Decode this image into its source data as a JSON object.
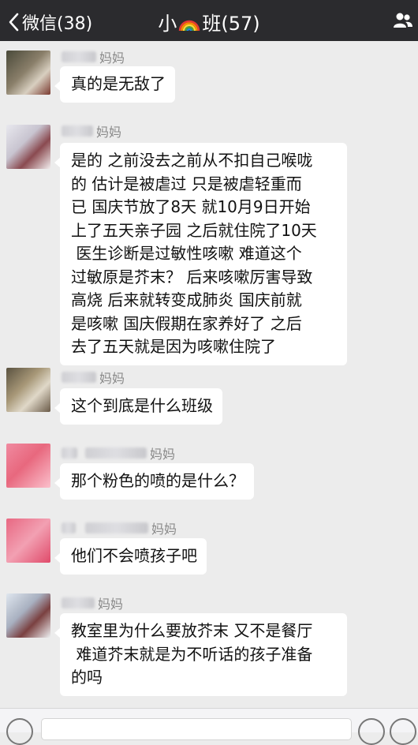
{
  "navbar": {
    "back_label": "微信(38)",
    "title_prefix": "小",
    "title_suffix": "班(57)"
  },
  "messages": [
    {
      "nick": "妈妈",
      "text": "真的是无敌了"
    },
    {
      "nick": "妈妈",
      "text": "是的 之前没去之前从不扣自己喉咙\n的 估计是被虐过 只是被虐轻重而\n已 国庆节放了8天 就10月9日开始\n上了五天亲子园 之后就住院了10天\n 医生诊断是过敏性咳嗽 难道这个\n过敏原是芥末？ 后来咳嗽厉害导致\n高烧 后来就转变成肺炎 国庆前就\n是咳嗽 国庆假期在家养好了 之后\n去了五天就是因为咳嗽住院了"
    },
    {
      "nick": "妈妈",
      "text": "这个到底是什么班级"
    },
    {
      "nick": "妈妈",
      "text": "那个粉色的喷的是什么？"
    },
    {
      "nick": "妈妈",
      "text": "他们不会喷孩子吧"
    },
    {
      "nick": "妈妈",
      "text": "教室里为什么要放芥末 又不是餐厅\n 难道芥末就是为不听话的孩子准备\n的吗"
    }
  ],
  "colors": {
    "navbar_bg": "#2b2b2e",
    "chat_bg": "#ececec",
    "bubble_bg": "#ffffff"
  },
  "icons": {
    "back": "chevron-left-icon",
    "title_emoji": "rainbow-icon",
    "group_info": "people-icon",
    "voice": "voice-icon",
    "emoji": "emoji-icon",
    "add": "plus-icon"
  }
}
